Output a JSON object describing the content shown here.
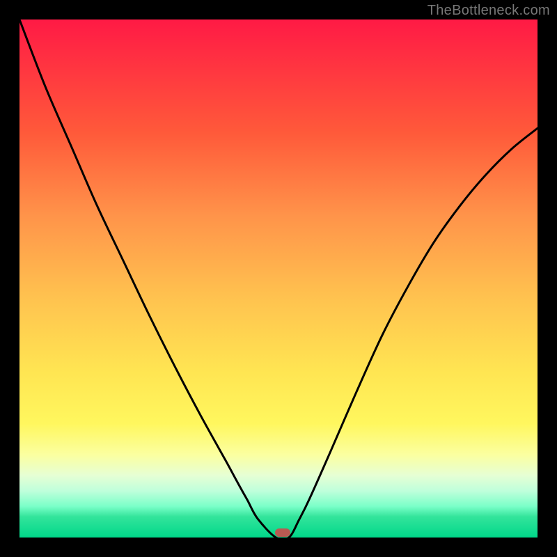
{
  "watermark": "TheBottleneck.com",
  "chart_data": {
    "type": "line",
    "title": "",
    "xlabel": "",
    "ylabel": "",
    "xlim": [
      0,
      1
    ],
    "ylim": [
      0,
      1
    ],
    "series": [
      {
        "name": "bottleneck-curve",
        "x": [
          0.0,
          0.05,
          0.1,
          0.15,
          0.2,
          0.25,
          0.3,
          0.35,
          0.4,
          0.42,
          0.44,
          0.46,
          0.495,
          0.52,
          0.54,
          0.56,
          0.6,
          0.65,
          0.7,
          0.75,
          0.8,
          0.85,
          0.9,
          0.95,
          1.0
        ],
        "y": [
          1.0,
          0.87,
          0.755,
          0.64,
          0.535,
          0.43,
          0.33,
          0.235,
          0.145,
          0.108,
          0.072,
          0.036,
          0.0,
          0.0,
          0.035,
          0.075,
          0.165,
          0.28,
          0.39,
          0.485,
          0.57,
          0.64,
          0.7,
          0.75,
          0.79
        ]
      }
    ],
    "marker": {
      "x": 0.508,
      "y": 0.01
    },
    "background": {
      "type": "gradient",
      "stops": [
        {
          "pos": 0.0,
          "color": "#ff1a45"
        },
        {
          "pos": 0.4,
          "color": "#ffa040"
        },
        {
          "pos": 0.75,
          "color": "#fff060"
        },
        {
          "pos": 1.0,
          "color": "#00d88a"
        }
      ]
    }
  }
}
